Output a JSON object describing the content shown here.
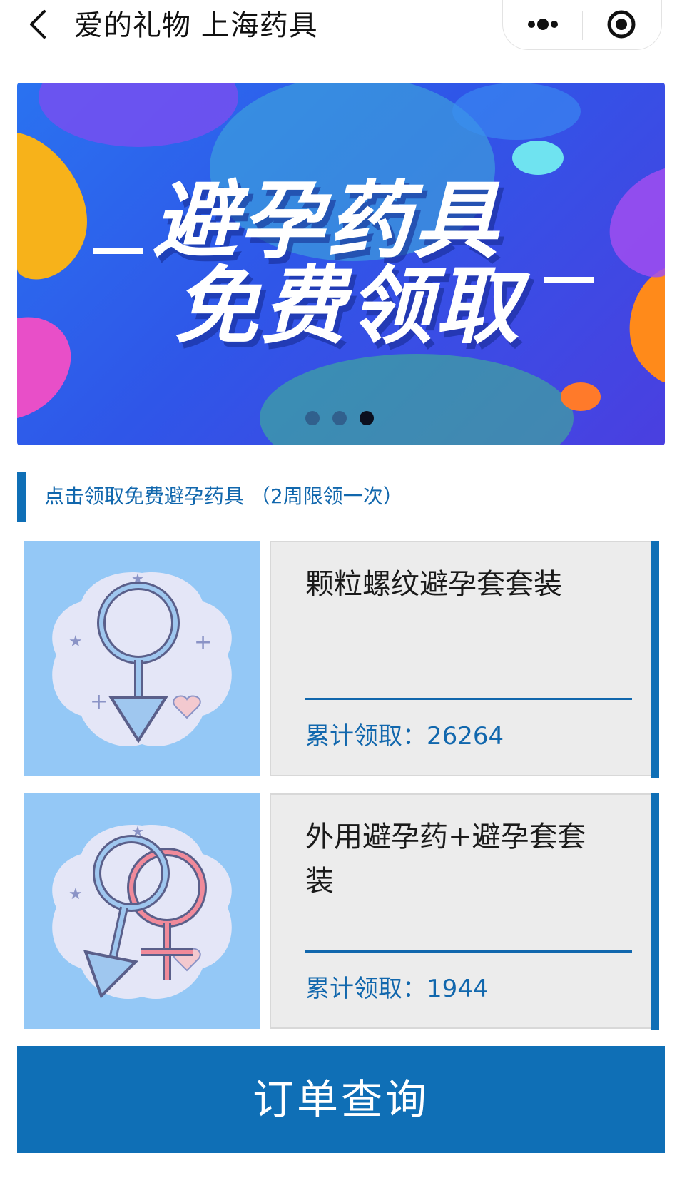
{
  "nav": {
    "title": "爱的礼物 上海药具"
  },
  "banner": {
    "line1": "避孕药具",
    "line2": "免费领取",
    "slide_count": 3,
    "active_slide": 3
  },
  "section": {
    "heading": "点击领取免费避孕药具 （2周限领一次）"
  },
  "products": [
    {
      "name": "颗粒螺纹避孕套套装",
      "count_label": "累计领取：",
      "count": "26264"
    },
    {
      "name": "外用避孕药+避孕套套装",
      "count_label": "累计领取：",
      "count": "1944"
    }
  ],
  "footer": {
    "order_button": "订单查询"
  },
  "colors": {
    "accent": "#0f6fb6",
    "thumb_bg": "#94c8f6",
    "card_bg": "#ececec"
  }
}
